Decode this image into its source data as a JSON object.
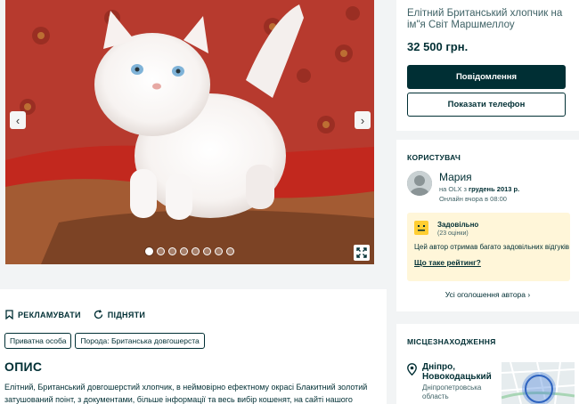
{
  "listing": {
    "title": "Елітний Британський хлопчик на ім\"я Світ Маршмеллоу",
    "price": "32 500 грн.",
    "message_button": "Повідомлення",
    "phone_button": "Показати телефон"
  },
  "gallery": {
    "photo_count": 8,
    "active_index": 0
  },
  "actions": {
    "promote": "РЕКЛАМУВАТИ",
    "raise": "ПІДНЯТИ"
  },
  "tags": [
    "Приватна особа",
    "Порода: Британська довгошерста"
  ],
  "description": {
    "heading": "ОПИС",
    "text": "Елітний, Британський довгошерстий хлопчик, в неймовірно ефектному окрасі Блакитний золотий затушований поінт, з документами, більше інформації та весь вибір кошенят, на сайті нашого"
  },
  "user": {
    "section_label": "КОРИСТУВАЧ",
    "name": "Мария",
    "since_prefix": "на OLX з",
    "since_date": "грудень 2013 р.",
    "online": "Онлайн вчора в 08:00",
    "rating_title": "Задовільно",
    "rating_count": "(23 оцінки)",
    "rating_text": "Цей автор отримав багато задовільних відгуків",
    "rating_link": "Що таке рейтинг?",
    "all_ads": "Усі оголошення автора"
  },
  "location": {
    "section_label": "МІСЦЕЗНАХОДЖЕННЯ",
    "city": "Дніпро, Новокодацький",
    "region": "Дніпропетровська область"
  },
  "colors": {
    "primary": "#002f34",
    "background": "#f2f4f5",
    "rating_bg": "#fff6d9",
    "rating_face": "#ffce32"
  }
}
